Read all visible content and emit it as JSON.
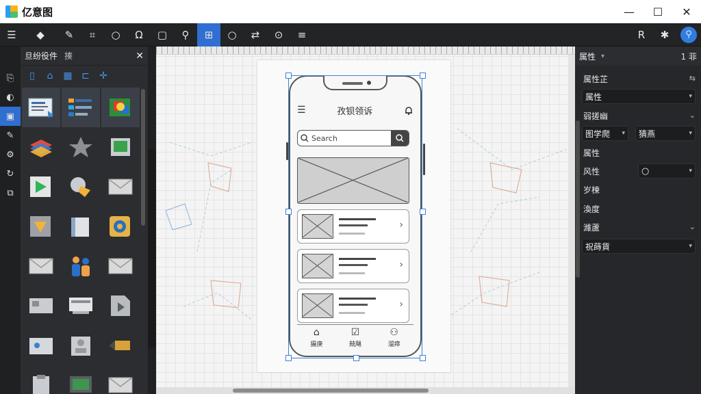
{
  "app": {
    "title": "亿意图"
  },
  "window": {
    "minimize": "—",
    "maximize": "☐",
    "close": "✕"
  },
  "toolbar": {
    "tools": [
      "list-icon",
      "paint-icon",
      "pen-icon",
      "crop-icon",
      "zoom-icon",
      "lasso-icon",
      "image-icon",
      "connector-icon",
      "grid-select-icon",
      "search-shape-icon",
      "transform-icon",
      "zoom-fit-icon",
      "align-icon"
    ],
    "active_index": 8,
    "right_tools": [
      "format-icon",
      "asterisk-icon",
      "search-icon"
    ]
  },
  "shapes_panel": {
    "title": "旦纷役件",
    "subtitle": "揍",
    "close": "✕"
  },
  "canvas": {
    "phone": {
      "title": "孜钡领诉",
      "search_placeholder": "Search",
      "tabs": [
        {
          "icon": "home-icon",
          "label": "摄庚"
        },
        {
          "icon": "checkbox-icon",
          "label": "兢飓"
        },
        {
          "icon": "user-icon",
          "label": "溜瘁"
        }
      ]
    }
  },
  "properties": {
    "header": "属性",
    "header_num": "1 菲",
    "rows": {
      "r1": "属性芷",
      "r2": "属性",
      "r3": "弱搓幽",
      "r4a": "图学爬",
      "r4b": "猜燕",
      "r5": "属性",
      "r6": "风性",
      "r7": "岁楝",
      "r8": "渙度",
      "r9": "濰蘆",
      "r10": "祝蒔貨"
    }
  }
}
